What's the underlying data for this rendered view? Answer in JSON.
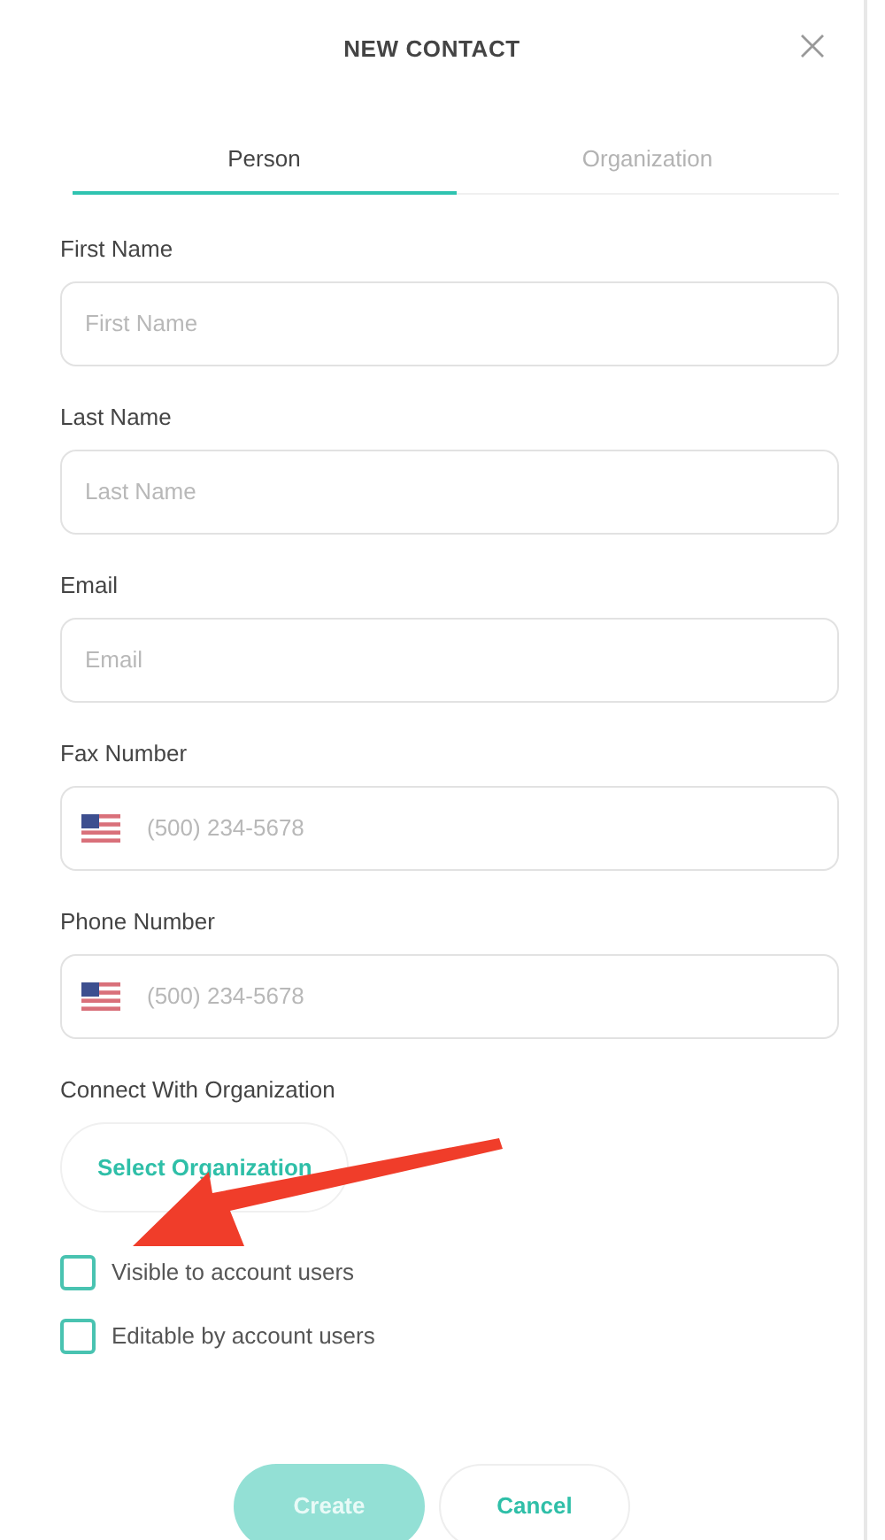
{
  "dialog": {
    "title": "NEW CONTACT"
  },
  "tabs": [
    {
      "label": "Person",
      "selected": true
    },
    {
      "label": "Organization",
      "selected": false
    }
  ],
  "fields": [
    {
      "kind": "text",
      "label": "First Name",
      "placeholder": "First Name"
    },
    {
      "kind": "text",
      "label": "Last Name",
      "placeholder": "Last Name"
    },
    {
      "kind": "text",
      "label": "Email",
      "placeholder": "Email"
    },
    {
      "kind": "phone",
      "label": "Fax Number",
      "placeholder": "(500) 234-5678"
    },
    {
      "kind": "phone",
      "label": "Phone Number",
      "placeholder": "(500) 234-5678"
    }
  ],
  "organization": {
    "label": "Connect With Organization",
    "button": "Select Organization"
  },
  "checkboxes": [
    {
      "label": "Visible to account users",
      "checked": false
    },
    {
      "label": "Editable by account users",
      "checked": false
    }
  ],
  "buttons": [
    {
      "kind": "primary",
      "label": "Create",
      "disabled": true
    },
    {
      "kind": "secondary",
      "label": "Cancel",
      "disabled": false
    }
  ]
}
